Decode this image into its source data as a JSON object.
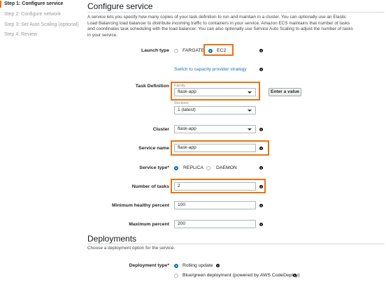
{
  "sidebar": {
    "steps": [
      {
        "label": "Step 1: Configure service"
      },
      {
        "label": "Step 2: Configure network"
      },
      {
        "label": "Step 3: Set Auto Scaling (optional)"
      },
      {
        "label": "Step 4: Review"
      }
    ]
  },
  "section": {
    "title": "Configure service",
    "description": "A service lets you specify how many copies of your task definition to run and maintain in a cluster. You can optionally use an Elastic Load Balancing load balancer to distribute incoming traffic to containers in your service. Amazon ECS maintains that number of tasks and coordinates task scheduling with the load balancer. You can also optionally use Service Auto Scaling to adjust the number of tasks in your service."
  },
  "launch_type": {
    "label": "Launch type",
    "options": [
      "FARGATE",
      "EC2"
    ],
    "selected": "EC2",
    "switch_link": "Switch to capacity provider strategy"
  },
  "task_definition": {
    "label": "Task Definition",
    "family_label": "Family",
    "family_value": "flask-app",
    "enter_value_button": "Enter a value",
    "revision_label": "Revision",
    "revision_value": "1 (latest)"
  },
  "cluster": {
    "label": "Cluster",
    "value": "flask-app"
  },
  "service_name": {
    "label": "Service name",
    "value": "flask-app"
  },
  "service_type": {
    "label": "Service type*",
    "options": [
      "REPLICA",
      "DAEMON"
    ],
    "selected": "REPLICA"
  },
  "number_of_tasks": {
    "label": "Number of tasks",
    "value": "2"
  },
  "min_healthy": {
    "label": "Minimum healthy percent",
    "value": "100"
  },
  "max_percent": {
    "label": "Maximum percent",
    "value": "200"
  },
  "deployments": {
    "title": "Deployments",
    "description": "Choose a deployment option for the service.",
    "type_label": "Deployment type*",
    "options": [
      "Rolling update",
      "Blue/green deployment (powered by AWS CodeDeploy)"
    ],
    "selected": "Rolling update"
  },
  "info_glyph": "i",
  "colors": {
    "highlight": "#ec7211",
    "link": "#1a73b8",
    "radio": "#0073bb"
  }
}
